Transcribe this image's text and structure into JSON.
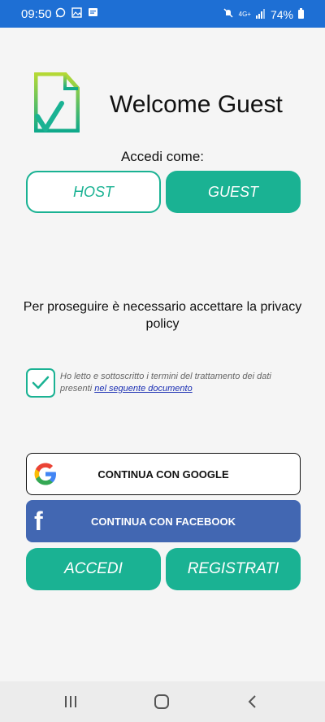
{
  "status_bar": {
    "time": "09:50",
    "icons_left": [
      "whatsapp-icon",
      "gallery-icon",
      "message-icon"
    ],
    "icons_right": [
      "mute-icon",
      "4g-icon",
      "signal-icon",
      "battery-icon"
    ],
    "network": "4G+",
    "battery": "74%"
  },
  "header": {
    "title": "Welcome Guest"
  },
  "role_selector": {
    "prompt": "Accedi come:",
    "host_label": "HOST",
    "guest_label": "GUEST"
  },
  "privacy": {
    "notice": "Per proseguire è necessario accettare la privacy policy",
    "consent_text": "Ho letto e sottoscritto i termini del trattamento dei dati presenti",
    "consent_link": "nel seguente documento",
    "checked": true
  },
  "social": {
    "google_label": "CONTINUA CON GOOGLE",
    "facebook_label": "CONTINUA CON FACEBOOK"
  },
  "actions": {
    "login_label": "ACCEDI",
    "register_label": "REGISTRATI"
  },
  "nav_bar": {
    "items": [
      "recents-icon",
      "home-icon",
      "back-icon"
    ]
  },
  "colors": {
    "accent": "#1ab293",
    "status_bar": "#1e6fd4",
    "facebook": "#4267b2",
    "link": "#1b2fb3"
  }
}
